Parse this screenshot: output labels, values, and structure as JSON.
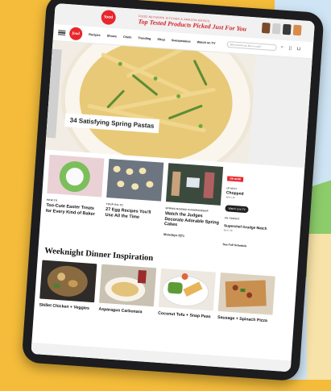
{
  "promo": {
    "badge": "food",
    "small": "FOOD NETWORK KITCHEN & AMAZON BASICS",
    "headline": "Top Tested Products Picked Just For You"
  },
  "nav": {
    "logo": "food",
    "items": [
      "Recipes",
      "Shows",
      "Chefs",
      "Trending",
      "Shop",
      "Sweepstakes",
      "Watch on TV"
    ],
    "search_placeholder": "What would you like to cook?"
  },
  "hero": {
    "title": "34 Satisfying Spring Pastas"
  },
  "cards": [
    {
      "tag": "HOW-TO",
      "title": "Too-Cute Easter Treats for Every Kind of Baker"
    },
    {
      "tag": "YOUR GO-TO",
      "title": "27 Egg Recipes You'll Use All the Time"
    },
    {
      "tag": "SPRING BAKING CHAMPIONSHIP",
      "title": "Watch the Judges Decorate Adorable Spring Cakes",
      "sub": "Mondays 8|7c"
    }
  ],
  "tv": {
    "live": "ON NOW",
    "up_next": "UP NEXT",
    "show": "Chopped",
    "time": "9pm | 8c",
    "watch": "Watch Live TV",
    "on_tonight": "ON TONIGHT",
    "episode": "Superchef Grudge Match",
    "ep_time": "9pm | 8c",
    "link": "See Full Schedule"
  },
  "section_title": "Weeknight Dinner Inspiration",
  "dinners": [
    {
      "title": "Skillet Chicken + Veggies"
    },
    {
      "title": "Asparagus Carbonara"
    },
    {
      "title": "Coconut Tofu + Snap Peas"
    },
    {
      "title": "Sausage + Spinach Pizza"
    }
  ]
}
